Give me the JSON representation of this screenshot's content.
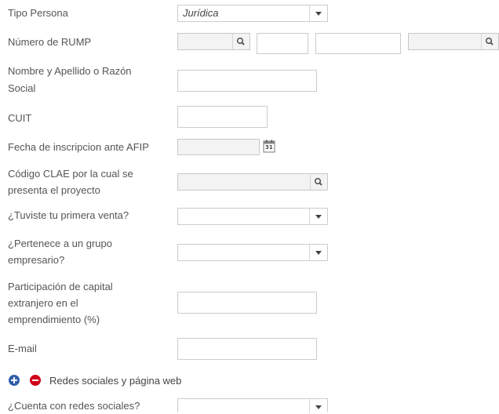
{
  "fields": {
    "tipo_persona": {
      "label": "Tipo Persona",
      "value": "Jurídica"
    },
    "rump": {
      "label": "Número de RUMP"
    },
    "nombre": {
      "label_line1": "Nombre y Apellido o Razón",
      "label_line2": "Social"
    },
    "cuit": {
      "label": "CUIT"
    },
    "fecha": {
      "label": "Fecha de inscripcion ante AFIP"
    },
    "clae": {
      "label_line1": "Código CLAE por la cual se",
      "label_line2": "presenta el proyecto"
    },
    "primera_venta": {
      "label": "¿Tuviste tu primera venta?"
    },
    "grupo": {
      "label_line1": "¿Pertenece a un grupo",
      "label_line2": "empresario?"
    },
    "capital": {
      "label_line1": "Participación de capital",
      "label_line2": "extranjero en el",
      "label_line3": "emprendimiento (%)"
    },
    "email": {
      "label": "E-mail"
    },
    "redes": {
      "label": "¿Cuenta con redes sociales?"
    }
  },
  "section": {
    "title": "Redes sociales y página web"
  },
  "icons": {
    "search": "search-icon",
    "calendar": "calendar-icon",
    "add": "add-circle-icon",
    "remove": "remove-circle-icon",
    "dropdown": "chevron-down-icon"
  },
  "calendar_day": "31",
  "colors": {
    "add": "#2f5fa8",
    "remove": "#d0021b",
    "label": "#555555",
    "border": "#cccccc"
  }
}
